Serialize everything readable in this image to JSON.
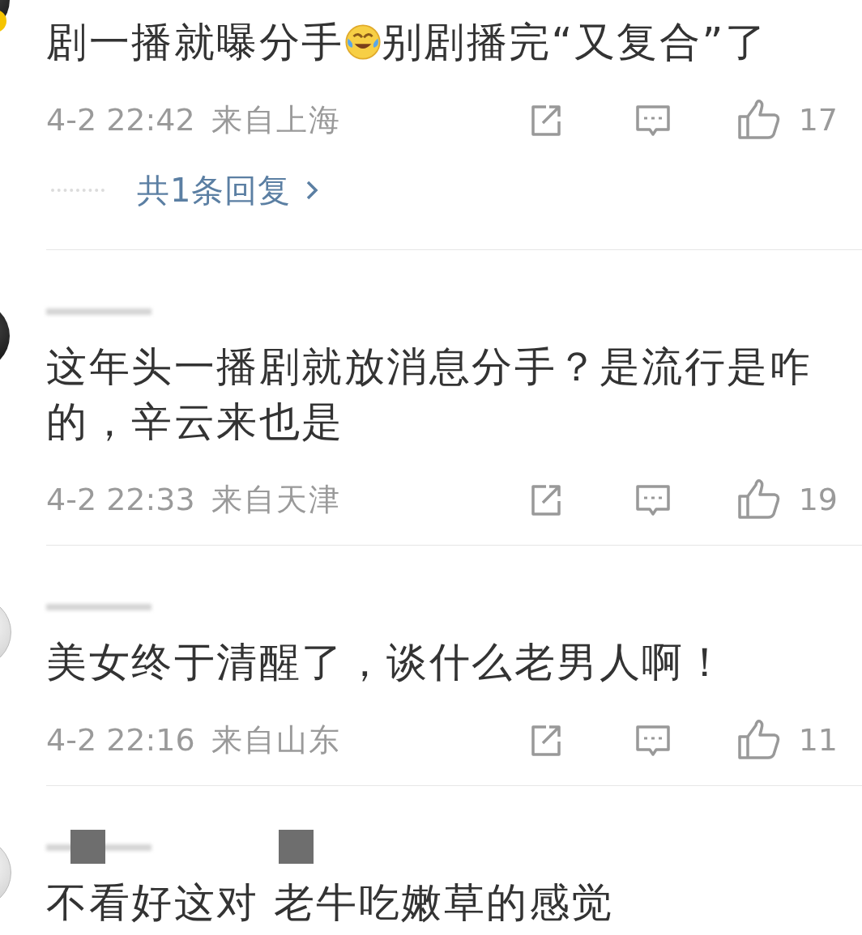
{
  "comments": [
    {
      "avatar": {
        "kind": "dark",
        "badge": true
      },
      "content": [
        {
          "kind": "text",
          "text": "剧一播就曝分手"
        },
        {
          "kind": "emoji"
        },
        {
          "kind": "text",
          "text": "别剧播完“又复合”了"
        }
      ],
      "time": "4-2 22:42",
      "location": "来自上海",
      "likes": "17",
      "replies": {
        "label": "共1条回复"
      }
    },
    {
      "avatar": {
        "kind": "dark",
        "badge": false
      },
      "username": {
        "redacted": false
      },
      "content": [
        {
          "kind": "text",
          "text": "这年头一播剧就放消息分手？是流行是咋的，辛云来也是"
        }
      ],
      "time": "4-2 22:33",
      "location": "来自天津",
      "likes": "19"
    },
    {
      "avatar": {
        "kind": "light",
        "badge": false
      },
      "username": {
        "redacted": false
      },
      "content": [
        {
          "kind": "text",
          "text": "美女终于清醒了，谈什么老男人啊！"
        }
      ],
      "time": "4-2 22:16",
      "location": "来自山东",
      "likes": "11"
    },
    {
      "avatar": {
        "kind": "light",
        "badge": false
      },
      "username": {
        "redacted": true
      },
      "content": [
        {
          "kind": "text",
          "text": "不看好这对 老牛吃嫩草的感觉"
        }
      ]
    }
  ]
}
